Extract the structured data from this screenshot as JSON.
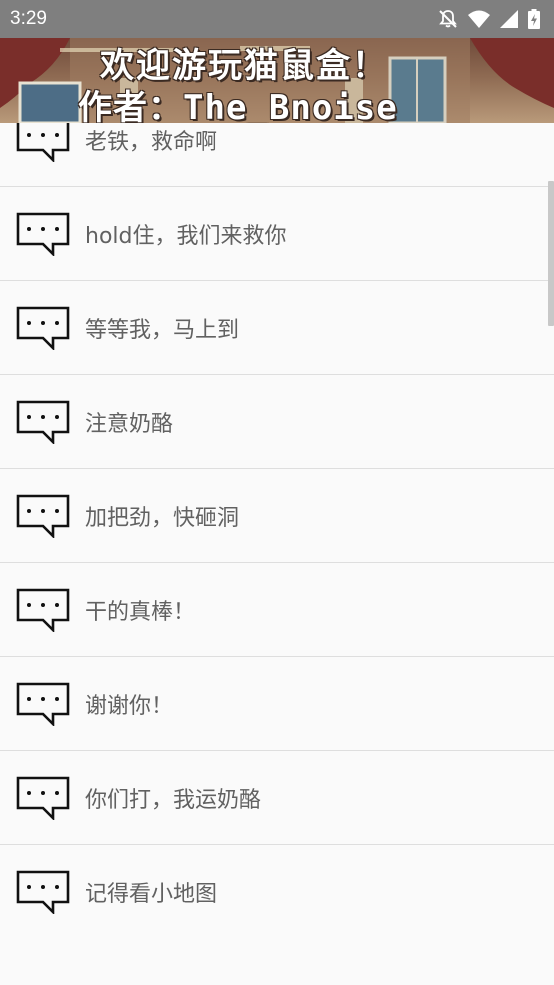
{
  "status_bar": {
    "time": "3:29",
    "icons": [
      "notifications-off-icon",
      "wifi-icon",
      "signal-icon",
      "battery-charging-icon"
    ]
  },
  "banner": {
    "line1": "欢迎游玩猫鼠盒！",
    "line2": "作者：The_Bnoise"
  },
  "messages": [
    {
      "label": "老铁，救命啊",
      "icon": "chat-bubble-icon"
    },
    {
      "label": "hold住，我们来救你",
      "icon": "chat-bubble-icon"
    },
    {
      "label": "等等我，马上到",
      "icon": "chat-bubble-icon"
    },
    {
      "label": "注意奶酪",
      "icon": "chat-bubble-icon"
    },
    {
      "label": "加把劲，快砸洞",
      "icon": "chat-bubble-icon"
    },
    {
      "label": "干的真棒！",
      "icon": "chat-bubble-icon"
    },
    {
      "label": "谢谢你！",
      "icon": "chat-bubble-icon"
    },
    {
      "label": "你们打，我运奶酪",
      "icon": "chat-bubble-icon"
    },
    {
      "label": "记得看小地图",
      "icon": "chat-bubble-icon"
    }
  ]
}
